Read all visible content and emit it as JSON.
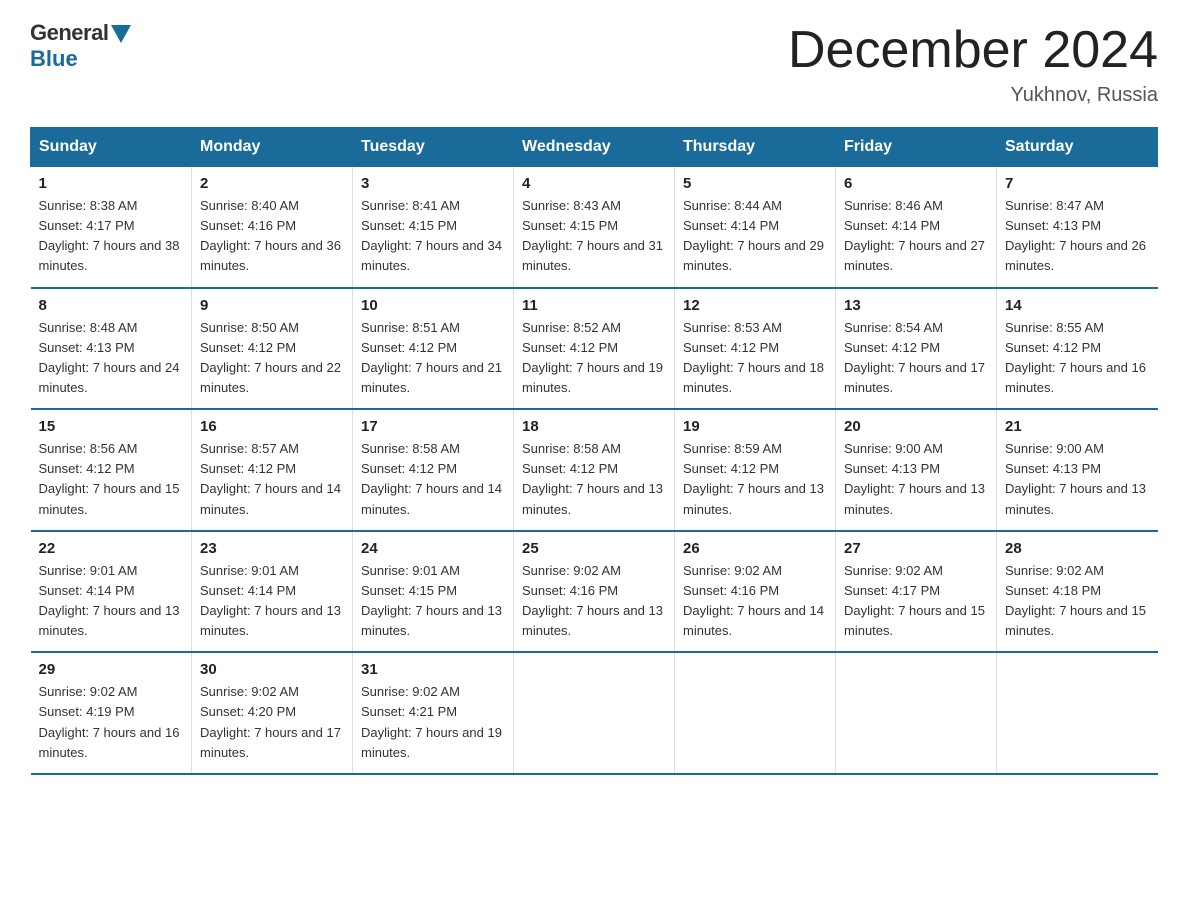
{
  "header": {
    "logo_general": "General",
    "logo_blue": "Blue",
    "title": "December 2024",
    "location": "Yukhnov, Russia"
  },
  "days_of_week": [
    "Sunday",
    "Monday",
    "Tuesday",
    "Wednesday",
    "Thursday",
    "Friday",
    "Saturday"
  ],
  "weeks": [
    [
      {
        "day": "1",
        "sunrise": "Sunrise: 8:38 AM",
        "sunset": "Sunset: 4:17 PM",
        "daylight": "Daylight: 7 hours and 38 minutes."
      },
      {
        "day": "2",
        "sunrise": "Sunrise: 8:40 AM",
        "sunset": "Sunset: 4:16 PM",
        "daylight": "Daylight: 7 hours and 36 minutes."
      },
      {
        "day": "3",
        "sunrise": "Sunrise: 8:41 AM",
        "sunset": "Sunset: 4:15 PM",
        "daylight": "Daylight: 7 hours and 34 minutes."
      },
      {
        "day": "4",
        "sunrise": "Sunrise: 8:43 AM",
        "sunset": "Sunset: 4:15 PM",
        "daylight": "Daylight: 7 hours and 31 minutes."
      },
      {
        "day": "5",
        "sunrise": "Sunrise: 8:44 AM",
        "sunset": "Sunset: 4:14 PM",
        "daylight": "Daylight: 7 hours and 29 minutes."
      },
      {
        "day": "6",
        "sunrise": "Sunrise: 8:46 AM",
        "sunset": "Sunset: 4:14 PM",
        "daylight": "Daylight: 7 hours and 27 minutes."
      },
      {
        "day": "7",
        "sunrise": "Sunrise: 8:47 AM",
        "sunset": "Sunset: 4:13 PM",
        "daylight": "Daylight: 7 hours and 26 minutes."
      }
    ],
    [
      {
        "day": "8",
        "sunrise": "Sunrise: 8:48 AM",
        "sunset": "Sunset: 4:13 PM",
        "daylight": "Daylight: 7 hours and 24 minutes."
      },
      {
        "day": "9",
        "sunrise": "Sunrise: 8:50 AM",
        "sunset": "Sunset: 4:12 PM",
        "daylight": "Daylight: 7 hours and 22 minutes."
      },
      {
        "day": "10",
        "sunrise": "Sunrise: 8:51 AM",
        "sunset": "Sunset: 4:12 PM",
        "daylight": "Daylight: 7 hours and 21 minutes."
      },
      {
        "day": "11",
        "sunrise": "Sunrise: 8:52 AM",
        "sunset": "Sunset: 4:12 PM",
        "daylight": "Daylight: 7 hours and 19 minutes."
      },
      {
        "day": "12",
        "sunrise": "Sunrise: 8:53 AM",
        "sunset": "Sunset: 4:12 PM",
        "daylight": "Daylight: 7 hours and 18 minutes."
      },
      {
        "day": "13",
        "sunrise": "Sunrise: 8:54 AM",
        "sunset": "Sunset: 4:12 PM",
        "daylight": "Daylight: 7 hours and 17 minutes."
      },
      {
        "day": "14",
        "sunrise": "Sunrise: 8:55 AM",
        "sunset": "Sunset: 4:12 PM",
        "daylight": "Daylight: 7 hours and 16 minutes."
      }
    ],
    [
      {
        "day": "15",
        "sunrise": "Sunrise: 8:56 AM",
        "sunset": "Sunset: 4:12 PM",
        "daylight": "Daylight: 7 hours and 15 minutes."
      },
      {
        "day": "16",
        "sunrise": "Sunrise: 8:57 AM",
        "sunset": "Sunset: 4:12 PM",
        "daylight": "Daylight: 7 hours and 14 minutes."
      },
      {
        "day": "17",
        "sunrise": "Sunrise: 8:58 AM",
        "sunset": "Sunset: 4:12 PM",
        "daylight": "Daylight: 7 hours and 14 minutes."
      },
      {
        "day": "18",
        "sunrise": "Sunrise: 8:58 AM",
        "sunset": "Sunset: 4:12 PM",
        "daylight": "Daylight: 7 hours and 13 minutes."
      },
      {
        "day": "19",
        "sunrise": "Sunrise: 8:59 AM",
        "sunset": "Sunset: 4:12 PM",
        "daylight": "Daylight: 7 hours and 13 minutes."
      },
      {
        "day": "20",
        "sunrise": "Sunrise: 9:00 AM",
        "sunset": "Sunset: 4:13 PM",
        "daylight": "Daylight: 7 hours and 13 minutes."
      },
      {
        "day": "21",
        "sunrise": "Sunrise: 9:00 AM",
        "sunset": "Sunset: 4:13 PM",
        "daylight": "Daylight: 7 hours and 13 minutes."
      }
    ],
    [
      {
        "day": "22",
        "sunrise": "Sunrise: 9:01 AM",
        "sunset": "Sunset: 4:14 PM",
        "daylight": "Daylight: 7 hours and 13 minutes."
      },
      {
        "day": "23",
        "sunrise": "Sunrise: 9:01 AM",
        "sunset": "Sunset: 4:14 PM",
        "daylight": "Daylight: 7 hours and 13 minutes."
      },
      {
        "day": "24",
        "sunrise": "Sunrise: 9:01 AM",
        "sunset": "Sunset: 4:15 PM",
        "daylight": "Daylight: 7 hours and 13 minutes."
      },
      {
        "day": "25",
        "sunrise": "Sunrise: 9:02 AM",
        "sunset": "Sunset: 4:16 PM",
        "daylight": "Daylight: 7 hours and 13 minutes."
      },
      {
        "day": "26",
        "sunrise": "Sunrise: 9:02 AM",
        "sunset": "Sunset: 4:16 PM",
        "daylight": "Daylight: 7 hours and 14 minutes."
      },
      {
        "day": "27",
        "sunrise": "Sunrise: 9:02 AM",
        "sunset": "Sunset: 4:17 PM",
        "daylight": "Daylight: 7 hours and 15 minutes."
      },
      {
        "day": "28",
        "sunrise": "Sunrise: 9:02 AM",
        "sunset": "Sunset: 4:18 PM",
        "daylight": "Daylight: 7 hours and 15 minutes."
      }
    ],
    [
      {
        "day": "29",
        "sunrise": "Sunrise: 9:02 AM",
        "sunset": "Sunset: 4:19 PM",
        "daylight": "Daylight: 7 hours and 16 minutes."
      },
      {
        "day": "30",
        "sunrise": "Sunrise: 9:02 AM",
        "sunset": "Sunset: 4:20 PM",
        "daylight": "Daylight: 7 hours and 17 minutes."
      },
      {
        "day": "31",
        "sunrise": "Sunrise: 9:02 AM",
        "sunset": "Sunset: 4:21 PM",
        "daylight": "Daylight: 7 hours and 19 minutes."
      },
      null,
      null,
      null,
      null
    ]
  ]
}
